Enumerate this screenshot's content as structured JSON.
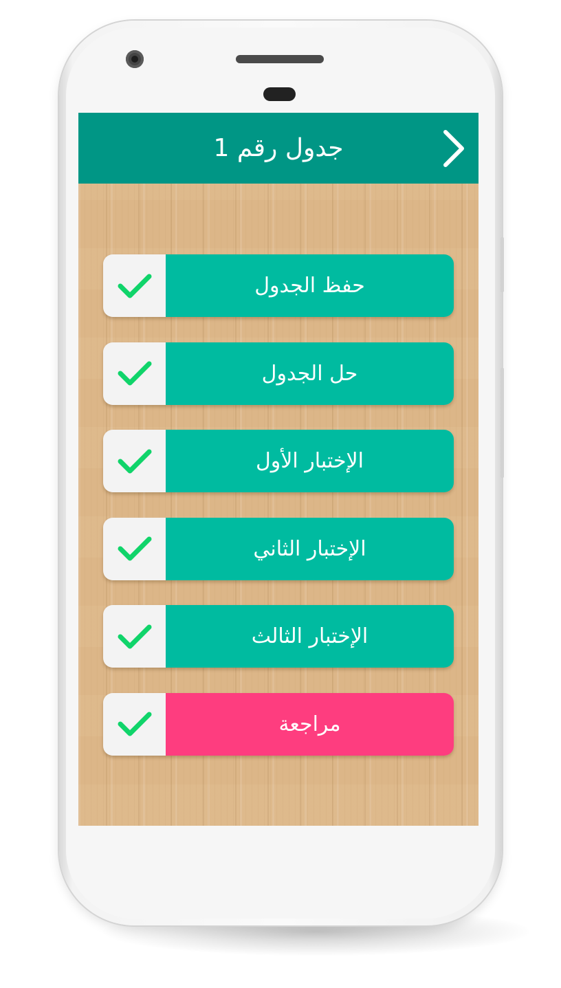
{
  "theme": {
    "header_color": "#009685",
    "item_color": "#00bba0",
    "review_color": "#fe3d7f",
    "check_color": "#10d46a",
    "wood_color": "#dcb688"
  },
  "header": {
    "title": "جدول رقم 1",
    "back_icon": "chevron-right-icon"
  },
  "menu": {
    "items": [
      {
        "label": "حفظ الجدول",
        "completed": true,
        "accent": "#00bba0"
      },
      {
        "label": "حل الجدول",
        "completed": true,
        "accent": "#00bba0"
      },
      {
        "label": "الإختبار الأول",
        "completed": true,
        "accent": "#00bba0"
      },
      {
        "label": "الإختبار الثاني",
        "completed": true,
        "accent": "#00bba0"
      },
      {
        "label": "الإختبار الثالث",
        "completed": true,
        "accent": "#00bba0"
      },
      {
        "label": "مراجعة",
        "completed": true,
        "accent": "#fe3d7f"
      }
    ]
  }
}
